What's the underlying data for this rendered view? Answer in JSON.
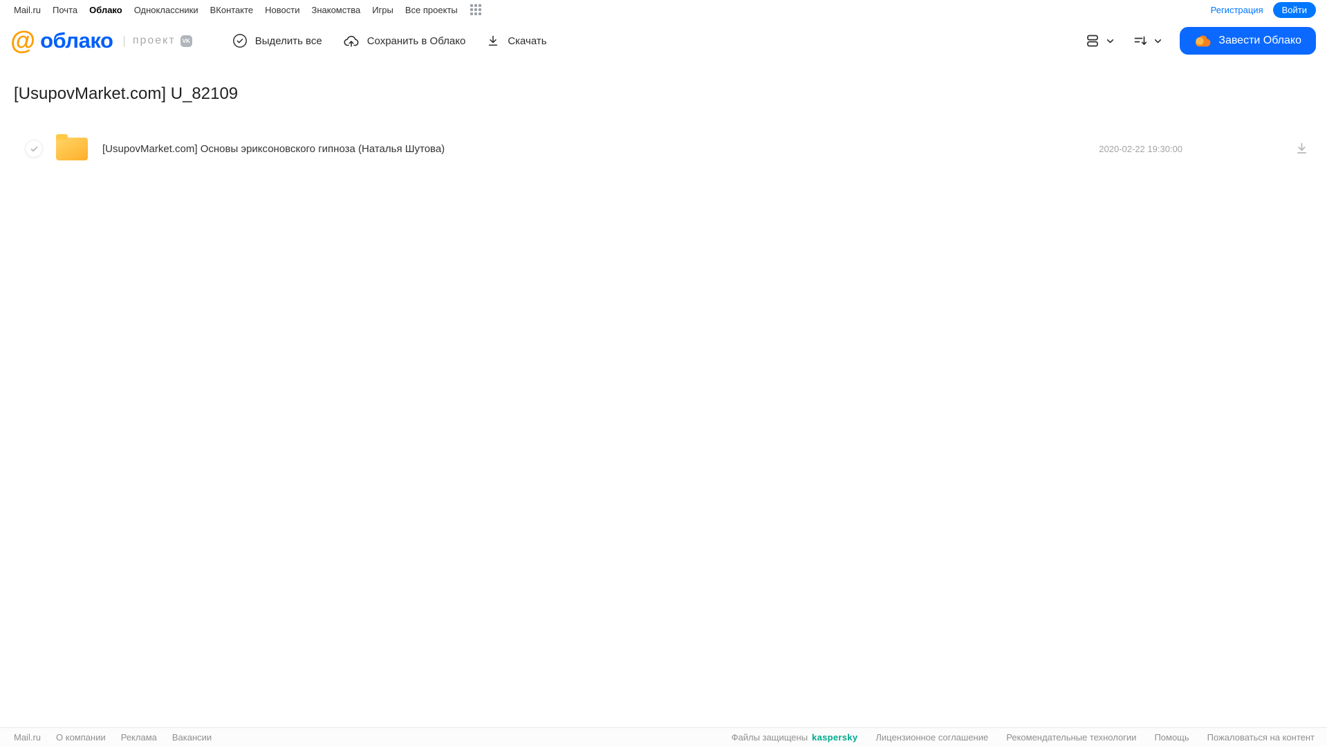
{
  "topnav": {
    "items": [
      "Mail.ru",
      "Почта",
      "Облако",
      "Одноклассники",
      "ВКонтакте",
      "Новости",
      "Знакомства",
      "Игры",
      "Все проекты"
    ],
    "registration": "Регистрация",
    "login": "Войти"
  },
  "header": {
    "logo_at": "@",
    "logo_text": "облако",
    "project_label": "проект",
    "vk_badge": "VK",
    "toolbar": {
      "select_all": "Выделить все",
      "save_to_cloud": "Сохранить в Облако",
      "download": "Скачать"
    },
    "get_cloud_button": "Завести Облако"
  },
  "page": {
    "title": "[UsupovMarket.com] U_82109"
  },
  "files": [
    {
      "type": "folder",
      "name": "[UsupovMarket.com] Основы эриксоновского гипноза (Наталья Шутова)",
      "date": "2020-02-22 19:30:00"
    }
  ],
  "footer": {
    "left_links": [
      "Mail.ru",
      "О компании",
      "Реклама",
      "Вакансии"
    ],
    "protected_text": "Файлы защищены",
    "kaspersky": "kaspersky",
    "right_links": [
      "Лицензионное соглашение",
      "Рекомендательные технологии",
      "Помощь",
      "Пожаловаться на контент"
    ]
  },
  "colors": {
    "accent_blue": "#0077ff",
    "button_blue": "#0b69ff",
    "logo_blue": "#005ff9",
    "logo_orange": "#ff9e00",
    "folder_yellow": "#ffb02a",
    "kaspersky_green": "#00a88e",
    "text_dark": "#2c2d2e",
    "text_gray": "#a3a3a3"
  }
}
